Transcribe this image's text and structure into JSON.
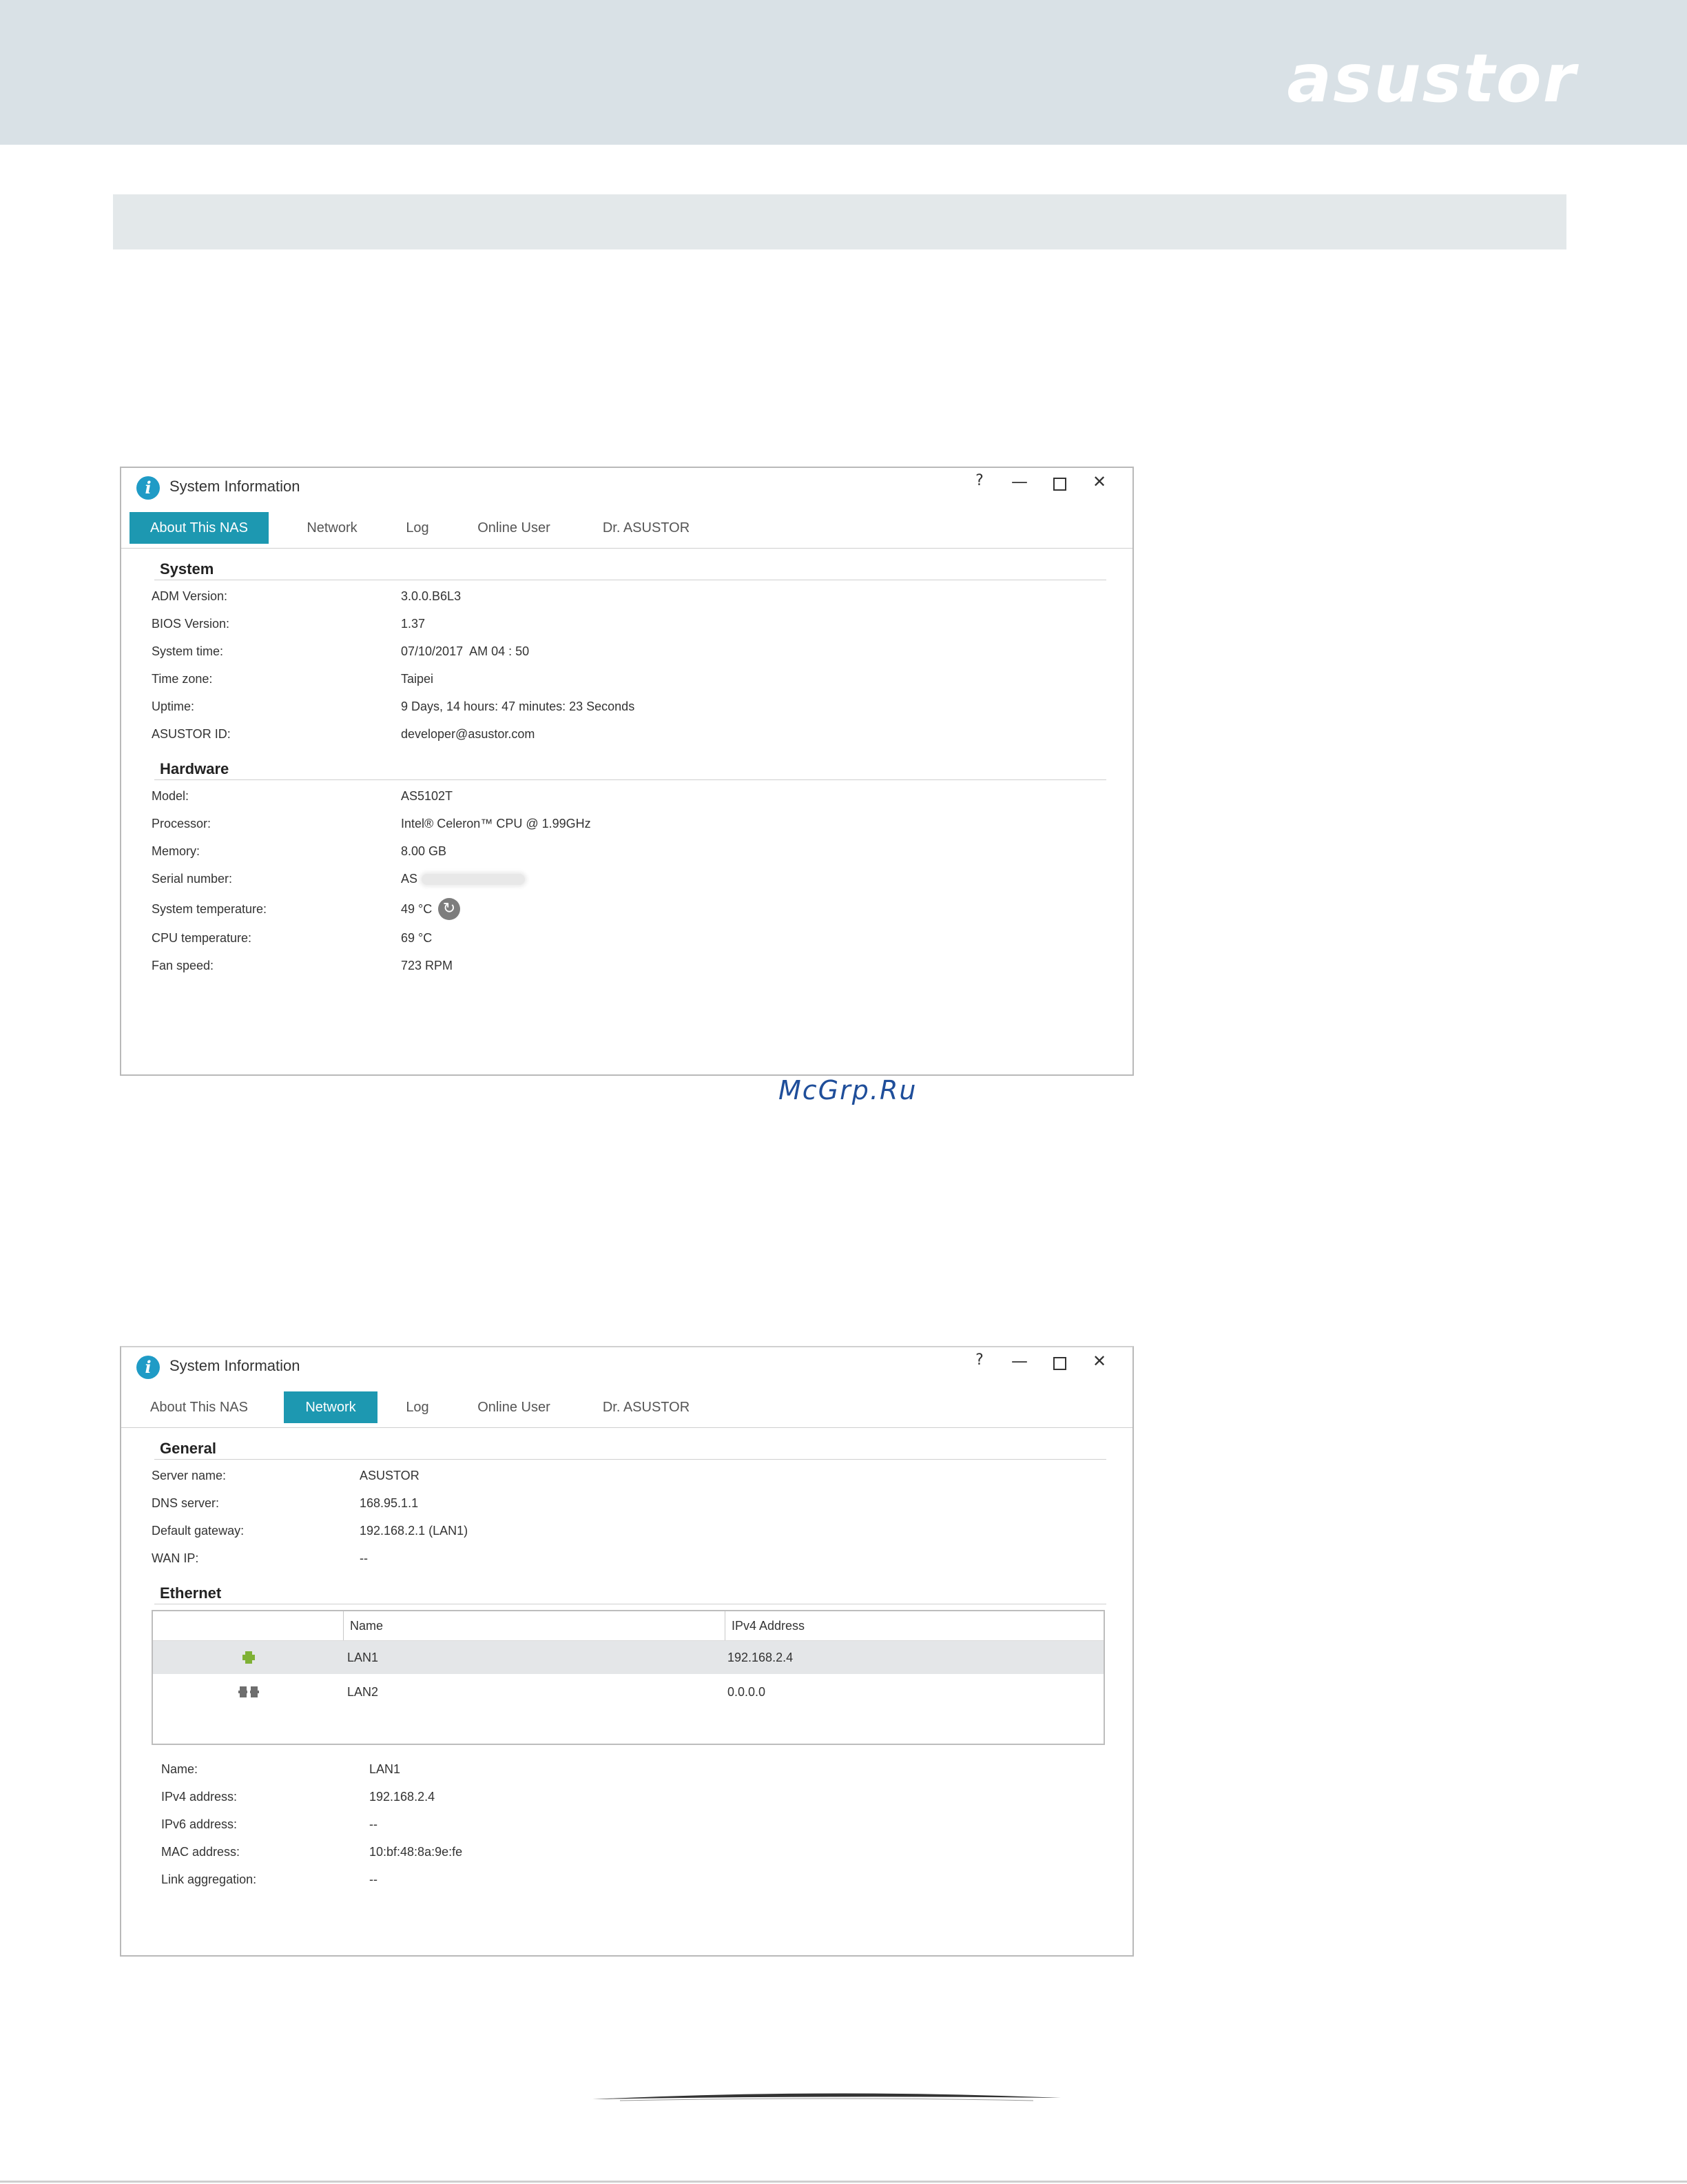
{
  "brand": {
    "logo_text": "asustor",
    "watermark": "McGrp.Ru"
  },
  "window1": {
    "title": "System Information",
    "controls": {
      "help": "?",
      "minimize": "—",
      "close": "✕"
    },
    "tabs": [
      "About This NAS",
      "Network",
      "Log",
      "Online User",
      "Dr. ASUSTOR"
    ],
    "active_tab": "About This NAS",
    "system": {
      "heading": "System",
      "rows": [
        {
          "label": "ADM Version:",
          "value": "3.0.0.B6L3"
        },
        {
          "label": "BIOS Version:",
          "value": "1.37"
        },
        {
          "label": "System time:",
          "value": "07/10/2017  AM 04 : 50"
        },
        {
          "label": "Time zone:",
          "value": "Taipei"
        },
        {
          "label": "Uptime:",
          "value": "9 Days, 14 hours: 47 minutes: 23 Seconds"
        },
        {
          "label": "ASUSTOR ID:",
          "value": "developer@asustor.com"
        }
      ]
    },
    "hardware": {
      "heading": "Hardware",
      "rows": [
        {
          "label": "Model:",
          "value": "AS5102T"
        },
        {
          "label": "Processor:",
          "value": "Intel® Celeron™ CPU @ 1.99GHz"
        },
        {
          "label": "Memory:",
          "value": "8.00 GB"
        },
        {
          "label": "Serial number:",
          "value": "AS"
        },
        {
          "label": "System temperature:",
          "value": "49 °C"
        },
        {
          "label": "CPU temperature:",
          "value": "69 °C"
        },
        {
          "label": "Fan speed:",
          "value": "723 RPM"
        }
      ]
    }
  },
  "window2": {
    "title": "System Information",
    "controls": {
      "help": "?",
      "minimize": "—",
      "close": "✕"
    },
    "tabs": [
      "About This NAS",
      "Network",
      "Log",
      "Online User",
      "Dr. ASUSTOR"
    ],
    "active_tab": "Network",
    "general": {
      "heading": "General",
      "rows": [
        {
          "label": "Server name:",
          "value": "ASUSTOR"
        },
        {
          "label": "DNS server:",
          "value": "168.95.1.1"
        },
        {
          "label": "Default gateway:",
          "value": "192.168.2.1 (LAN1)"
        },
        {
          "label": "WAN IP:",
          "value": "--"
        }
      ]
    },
    "ethernet": {
      "heading": "Ethernet",
      "columns": [
        "Name",
        "IPv4 Address"
      ],
      "rows": [
        {
          "name": "LAN1",
          "ipv4": "192.168.2.4",
          "icon": "connected-network-icon",
          "selected": true
        },
        {
          "name": "LAN2",
          "ipv4": "0.0.0.0",
          "icon": "disconnected-network-icon",
          "selected": false
        }
      ]
    },
    "details": [
      {
        "label": "Name:",
        "value": "LAN1"
      },
      {
        "label": "IPv4 address:",
        "value": "192.168.2.4"
      },
      {
        "label": "IPv6 address:",
        "value": "--"
      },
      {
        "label": "MAC address:",
        "value": "10:bf:48:8a:9e:fe"
      },
      {
        "label": "Link aggregation:",
        "value": "--"
      }
    ]
  },
  "colors": {
    "tab_active": "#1d98b1",
    "info_icon": "#1f9bc6",
    "connected": "#7fb135"
  }
}
